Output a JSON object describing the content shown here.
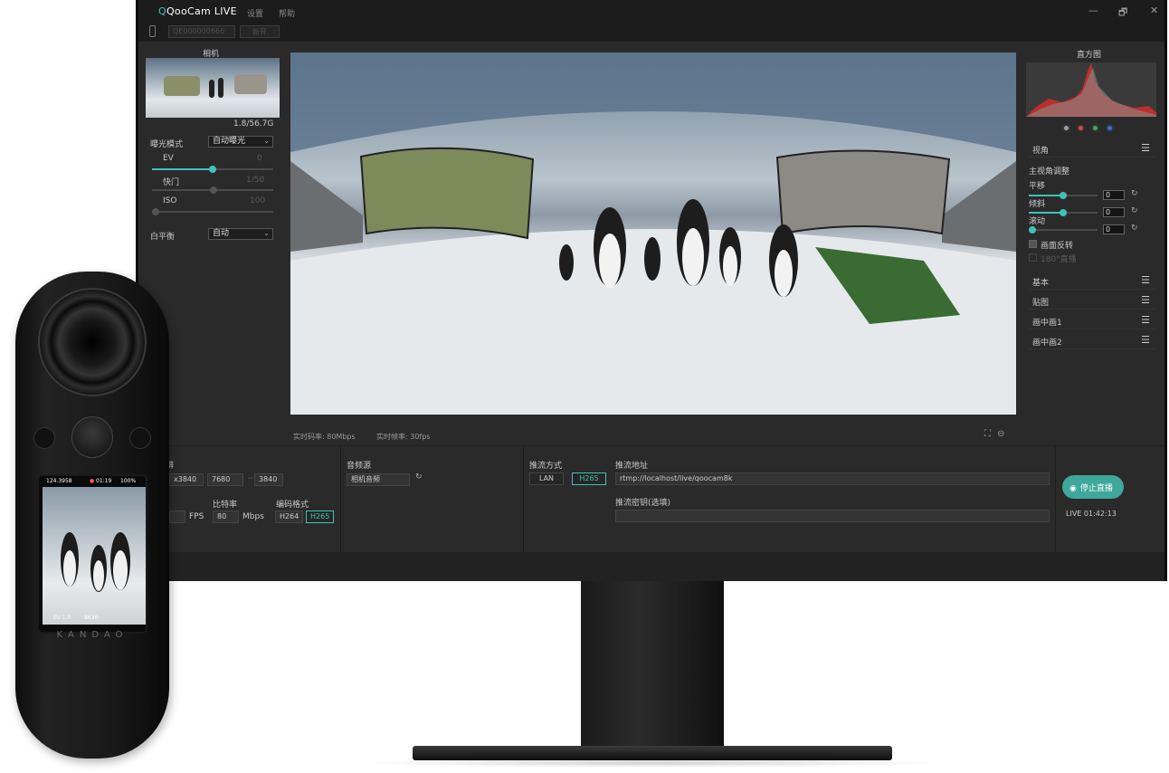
{
  "app": {
    "title": "QooCam LIVE",
    "menu": [
      "设置",
      "帮助"
    ],
    "window_controls": [
      "—",
      "🗗",
      "✕"
    ]
  },
  "device_row": {
    "serial": "QE000000666",
    "disconnect": "断开"
  },
  "left_panel": {
    "title": "相机",
    "storage": "1.8/56.7G",
    "exposure_mode_label": "曝光模式",
    "exposure_mode_value": "自动曝光",
    "ev_label": "EV",
    "ev_value": "0",
    "ev_level": 0.5,
    "shutter_label": "快门",
    "shutter_value": "1/50",
    "iso_label": "ISO",
    "iso_value": "100",
    "wb_label": "白平衡",
    "wb_value": "自动"
  },
  "preview": {
    "bitrate": "实时码率: 80Mbps",
    "fps": "实时帧率: 30fps"
  },
  "right_panel": {
    "histogram_title": "直方图",
    "channel_colors": [
      "#9aa0a6",
      "#e0453a",
      "#34b24a",
      "#3a6fe0"
    ],
    "view_section": "视角",
    "main_view_adjust": "主视角调整",
    "pan_label": "平移",
    "pan_value": "0",
    "tilt_label": "倾斜",
    "tilt_value": "0",
    "roll_label": "滚动",
    "roll_value": "0",
    "flip_label": "画面反转",
    "view180_label": "180°直播",
    "sections": [
      "基本",
      "贴图",
      "画中画1",
      "画中画2"
    ]
  },
  "bottom": {
    "resolution_label": "辨",
    "resolution_width": "x3840",
    "resolution_out_w": "7680",
    "resolution_x": "~",
    "resolution_out_h": "3840",
    "fps_unit": "FPS",
    "bitrate_label": "比特率",
    "bitrate_value": "80",
    "bitrate_unit": "Mbps",
    "codec_label": "编码格式",
    "codec_options": [
      "H264",
      "H265"
    ],
    "audio_label": "音频源",
    "audio_value": "相机音频",
    "stream_mode_label": "推流方式",
    "stream_mode_options": [
      "LAN",
      "H265"
    ],
    "stream_url_label": "推流地址",
    "stream_url": "rtmp://localhost/live/qoocam8k",
    "stream_key_label": "推流密钥(选填)",
    "stream_key": "",
    "live_button": "停止直播",
    "live_time": "LIVE 01:42:13"
  },
  "camera_screen": {
    "status_left": "124.3958",
    "rec_time": "01:19",
    "battery": "100%",
    "ev": "EV 1.0",
    "mode": "8K30",
    "brand": "KANDAO"
  },
  "colors": {
    "accent": "#3fc2b7",
    "panel_bg": "#2a2a2a",
    "live_button": "#3fa79c"
  }
}
